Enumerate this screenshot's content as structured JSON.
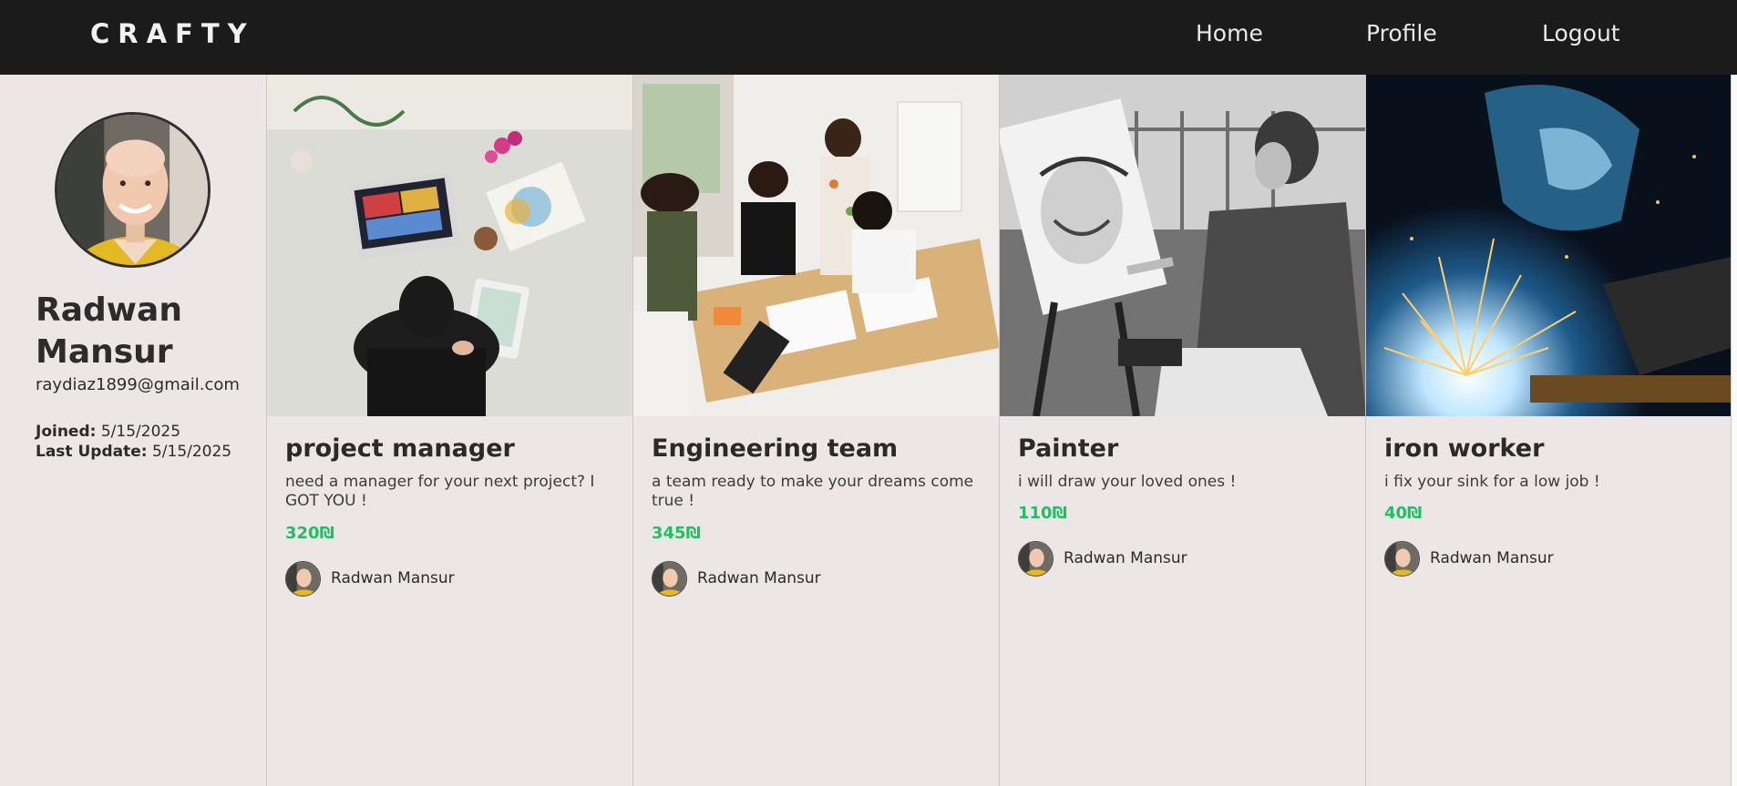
{
  "nav": {
    "brand": "CRAFTY",
    "links": [
      {
        "label": "Home"
      },
      {
        "label": "Profile"
      },
      {
        "label": "Logout"
      }
    ]
  },
  "profile": {
    "name": "Radwan Mansur",
    "email": "raydiaz1899@gmail.com",
    "joined_label": "Joined:",
    "joined_value": "5/15/2025",
    "updated_label": "Last Update:",
    "updated_value": "5/15/2025"
  },
  "cards": [
    {
      "title": "project manager",
      "description": "need a manager for your next project? I GOT YOU !",
      "price": "320₪",
      "author": "Radwan Mansur",
      "image": "workspace-photo"
    },
    {
      "title": "Engineering team",
      "description": "a team ready to make your dreams come true !",
      "price": "345₪",
      "author": "Radwan Mansur",
      "image": "team-meeting-photo"
    },
    {
      "title": "Painter",
      "description": "i will draw your loved ones !",
      "price": "110₪",
      "author": "Radwan Mansur",
      "image": "painter-photo"
    },
    {
      "title": "iron worker",
      "description": "i fix your sink for a low job !",
      "price": "40₪",
      "author": "Radwan Mansur",
      "image": "welding-photo"
    }
  ],
  "colors": {
    "navbar": "#1b1b1b",
    "background": "#ede6e6",
    "price": "#1ec060"
  }
}
